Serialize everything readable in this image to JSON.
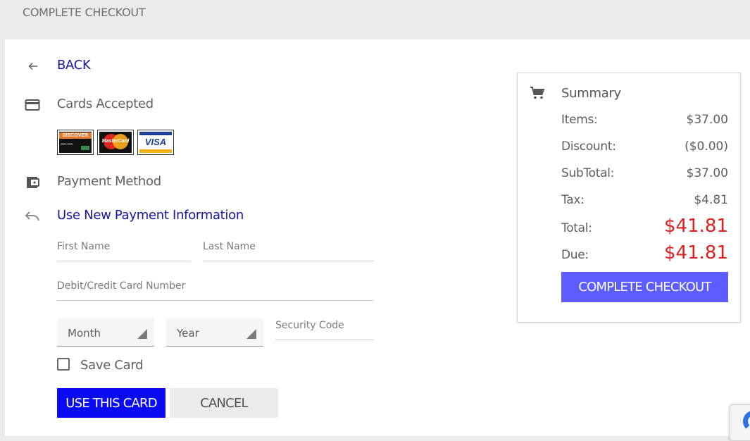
{
  "header": {
    "title": "COMPLETE CHECKOUT"
  },
  "nav": {
    "back_label": "BACK"
  },
  "cards_section": {
    "label": "Cards Accepted",
    "cards": [
      {
        "name": "discover",
        "text": "DISCOVER"
      },
      {
        "name": "mastercard",
        "text": "MasterCard"
      },
      {
        "name": "visa",
        "text": "VISA"
      }
    ]
  },
  "payment": {
    "label": "Payment Method",
    "new_info_label": "Use New Payment Information",
    "first_name_placeholder": "First Name",
    "last_name_placeholder": "Last Name",
    "card_number_placeholder": "Debit/Credit Card Number",
    "month_value": "Month",
    "year_value": "Year",
    "security_code_placeholder": "Security Code",
    "save_card_label": "Save Card",
    "save_card_checked": false,
    "use_card_label": "USE THIS CARD",
    "cancel_label": "CANCEL"
  },
  "summary": {
    "title": "Summary",
    "items_label": "Items:",
    "items_value": "$37.00",
    "discount_label": "Discount:",
    "discount_value": "($0.00)",
    "subtotal_label": "SubTotal:",
    "subtotal_value": "$37.00",
    "tax_label": "Tax:",
    "tax_value": "$4.81",
    "total_label": "Total:",
    "total_value": "$41.81",
    "due_label": "Due:",
    "due_value": "$41.81",
    "checkout_label": "COMPLETE CHECKOUT"
  },
  "colors": {
    "link": "#1515a8",
    "primary_button": "#0a0af5",
    "checkout_button": "#5c5cff",
    "total_red": "#e02020"
  },
  "icons": [
    "arrow-left-icon",
    "credit-card-icon",
    "wallet-icon",
    "undo-icon",
    "cart-icon"
  ]
}
